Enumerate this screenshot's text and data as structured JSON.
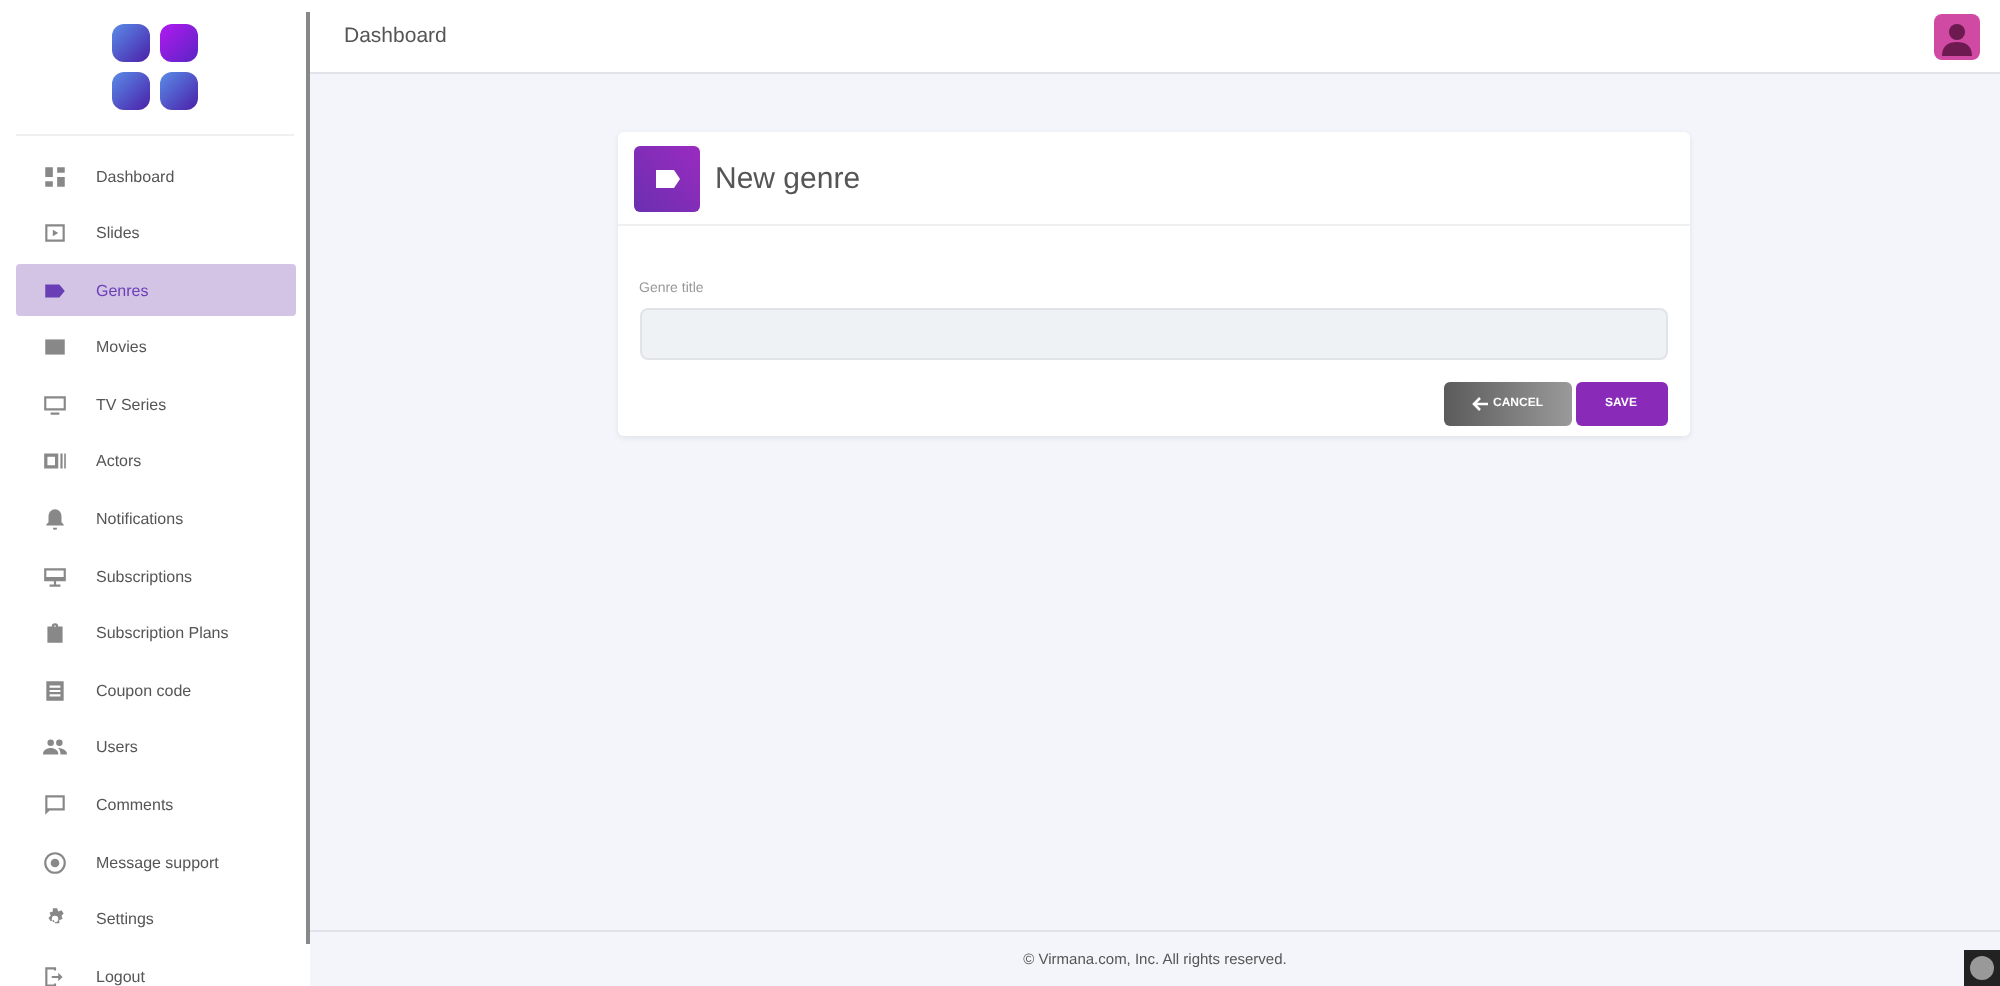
{
  "sidebar": {
    "items": [
      {
        "label": "Dashboard",
        "selected": false
      },
      {
        "label": "Slides",
        "selected": false
      },
      {
        "label": "Genres",
        "selected": true
      },
      {
        "label": "Movies",
        "selected": false
      },
      {
        "label": "TV Series",
        "selected": false
      },
      {
        "label": "Actors",
        "selected": false
      },
      {
        "label": "Notifications",
        "selected": false
      },
      {
        "label": "Subscriptions",
        "selected": false
      },
      {
        "label": "Subscription Plans",
        "selected": false
      },
      {
        "label": "Coupon code",
        "selected": false
      },
      {
        "label": "Users",
        "selected": false
      },
      {
        "label": "Comments",
        "selected": false
      },
      {
        "label": "Message support",
        "selected": false
      },
      {
        "label": "Settings",
        "selected": false
      },
      {
        "label": "Logout",
        "selected": false
      }
    ]
  },
  "header": {
    "title": "Dashboard"
  },
  "card": {
    "title": "New genre",
    "field": {
      "label": "Genre title"
    },
    "buttons": [
      {
        "label": "CANCEL",
        "kind": "cancel"
      },
      {
        "label": "SAVE",
        "kind": "save"
      }
    ]
  },
  "footer": {
    "text": "© Virmana.com, Inc. All rights reserved."
  }
}
